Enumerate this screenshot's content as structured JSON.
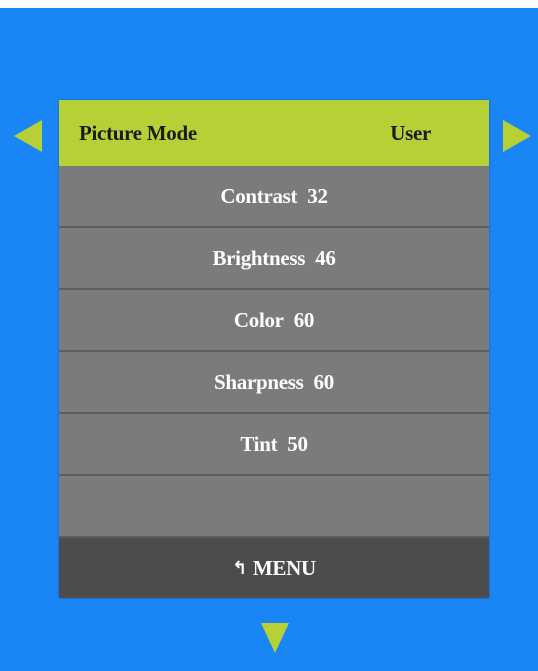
{
  "header": {
    "label": "Picture Mode",
    "value": "User"
  },
  "items": [
    {
      "label": "Contrast",
      "value": "32"
    },
    {
      "label": "Brightness",
      "value": "46"
    },
    {
      "label": "Color",
      "value": "60"
    },
    {
      "label": "Sharpness",
      "value": "60"
    },
    {
      "label": "Tint",
      "value": "50"
    }
  ],
  "footer": {
    "icon": "return-arrow-icon",
    "label": "MENU"
  },
  "colors": {
    "background": "#1a86f5",
    "accent": "#b6d135",
    "row": "#7b7b7b",
    "footer": "#4c4c4c"
  }
}
